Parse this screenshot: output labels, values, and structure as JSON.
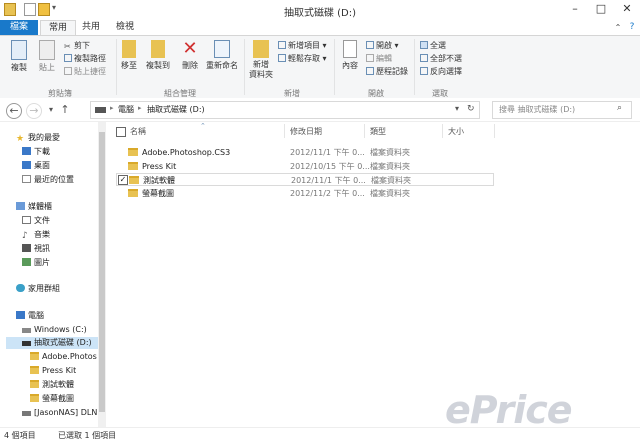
{
  "window": {
    "title": "抽取式磁碟 (D:)"
  },
  "ribbon": {
    "tabs": [
      "檔案",
      "常用",
      "共用",
      "檢視"
    ],
    "clipboard": {
      "copy": "複製",
      "paste": "貼上",
      "cut": "剪下",
      "copy_path": "複製路徑",
      "paste_shortcut": "貼上捷徑",
      "label": "剪貼簿"
    },
    "organize": {
      "move_to": "移至",
      "copy_to": "複製到",
      "delete": "刪除",
      "rename": "重新命名",
      "label": "組合管理"
    },
    "new": {
      "new_folder_l1": "新增",
      "new_folder_l2": "資料夾",
      "new_item": "新增項目 ▾",
      "easy_access": "輕鬆存取 ▾",
      "label": "新增"
    },
    "open": {
      "properties": "內容",
      "open": "開啟 ▾",
      "edit": "編輯",
      "history": "歷程記錄",
      "label": "開啟"
    },
    "select": {
      "select_all": "全選",
      "select_none": "全部不選",
      "invert": "反向選擇",
      "label": "選取"
    }
  },
  "address": {
    "crumbs": [
      "電腦",
      "抽取式磁碟 (D:)"
    ],
    "sep": "▸",
    "search_placeholder": "搜尋 抽取式磁碟 (D:)"
  },
  "navpane": {
    "items": [
      {
        "label": "我的最愛",
        "icon": "star-icon"
      },
      {
        "label": "下載",
        "icon": "download-icon"
      },
      {
        "label": "桌面",
        "icon": "desktop-icon"
      },
      {
        "label": "最近的位置",
        "icon": "recent-icon"
      },
      {
        "label": "媒體櫃",
        "icon": "library-icon"
      },
      {
        "label": "文件",
        "icon": "documents-icon"
      },
      {
        "label": "音樂",
        "icon": "music-icon"
      },
      {
        "label": "視訊",
        "icon": "video-icon"
      },
      {
        "label": "圖片",
        "icon": "pictures-icon"
      },
      {
        "label": "家用群組",
        "icon": "homegroup-icon"
      },
      {
        "label": "電腦",
        "icon": "computer-icon"
      },
      {
        "label": "Windows (C:)",
        "icon": "drive-icon"
      },
      {
        "label": "抽取式磁碟 (D:)",
        "icon": "removable-drive-icon"
      },
      {
        "label": "Adobe.Photos",
        "icon": "folder-icon"
      },
      {
        "label": "Press Kit",
        "icon": "folder-icon"
      },
      {
        "label": "測試軟體",
        "icon": "folder-icon"
      },
      {
        "label": "螢幕截圖",
        "icon": "folder-icon"
      },
      {
        "label": "[JasonNAS] DLN",
        "icon": "network-drive-icon"
      }
    ]
  },
  "filelist": {
    "headers": {
      "name": "名稱",
      "date": "修改日期",
      "type": "類型",
      "size": "大小"
    },
    "rows": [
      {
        "name": "Adobe.Photoshop.CS3",
        "date": "2012/11/1 下午 0...",
        "type": "檔案資料夾",
        "checked": false
      },
      {
        "name": "Press Kit",
        "date": "2012/10/15 下午 0...",
        "type": "檔案資料夾",
        "checked": false
      },
      {
        "name": "測試軟體",
        "date": "2012/11/1 下午 0...",
        "type": "檔案資料夾",
        "checked": true
      },
      {
        "name": "螢幕截圖",
        "date": "2012/11/2 下午 0...",
        "type": "檔案資料夾",
        "checked": false
      }
    ]
  },
  "status": {
    "count": "4 個項目",
    "selected": "已選取 1 個項目"
  },
  "watermark": "ePrice",
  "colors": {
    "file_tab": "#1979ca",
    "folder": "#e8c252",
    "ribbon_bg": "#f5f6f7"
  }
}
